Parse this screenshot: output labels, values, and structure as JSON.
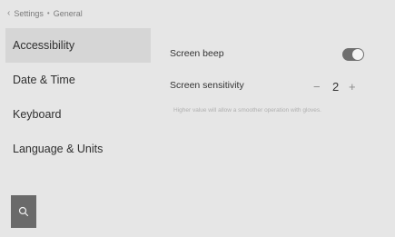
{
  "breadcrumb": {
    "back_icon": "chevron-left-icon",
    "items": [
      "Settings",
      "General"
    ],
    "separator": "•"
  },
  "sidebar": {
    "items": [
      {
        "label": "Accessibility",
        "active": true
      },
      {
        "label": "Date & Time",
        "active": false
      },
      {
        "label": "Keyboard",
        "active": false
      },
      {
        "label": "Language & Units",
        "active": false
      }
    ],
    "search_icon": "search-icon"
  },
  "settings": {
    "screen_beep": {
      "label": "Screen beep",
      "enabled": true
    },
    "screen_sensitivity": {
      "label": "Screen sensitivity",
      "value": "2",
      "minus": "−",
      "plus": "+",
      "hint": "Higher value will allow a smoother operation with gloves."
    }
  },
  "colors": {
    "background": "#e6e6e6",
    "active_item": "#d6d6d6",
    "toggle_on": "#6f6f6f",
    "search_button": "#6a6a6a"
  }
}
